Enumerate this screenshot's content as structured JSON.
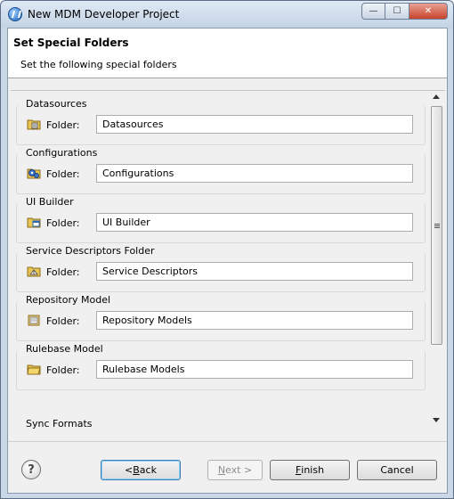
{
  "window": {
    "title": "New MDM Developer Project",
    "minimize_glyph": "—",
    "maximize_glyph": "☐",
    "close_glyph": "✕"
  },
  "banner": {
    "title": "Set Special Folders",
    "subtitle": "Set the following special folders"
  },
  "folders": [
    {
      "group": "Datasources",
      "label": "Folder:",
      "value": "Datasources",
      "icon": "datasource-folder-icon"
    },
    {
      "group": "Configurations",
      "label": "Folder:",
      "value": "Configurations",
      "icon": "configuration-folder-icon"
    },
    {
      "group": "UI Builder",
      "label": "Folder:",
      "value": "UI Builder",
      "icon": "ui-builder-folder-icon"
    },
    {
      "group": "Service Descriptors Folder",
      "label": "Folder:",
      "value": "Service Descriptors",
      "icon": "service-descriptor-folder-icon"
    },
    {
      "group": "Repository Model",
      "label": "Folder:",
      "value": "Repository Models",
      "icon": "repository-folder-icon"
    },
    {
      "group": "Rulebase Model",
      "label": "Folder:",
      "value": "Rulebase Models",
      "icon": "rulebase-folder-icon"
    }
  ],
  "partially_visible_group": "Sync Formats",
  "buttons": {
    "help": "?",
    "back_prefix": "< ",
    "back_mnemonic": "B",
    "back_rest": "ack",
    "next_mnemonic": "N",
    "next_rest": "ext >",
    "finish_mnemonic": "F",
    "finish_rest": "inish",
    "cancel": "Cancel"
  },
  "colors": {
    "folder_yellow": "#e8c453",
    "default_button_border": "#3c7fb1"
  }
}
